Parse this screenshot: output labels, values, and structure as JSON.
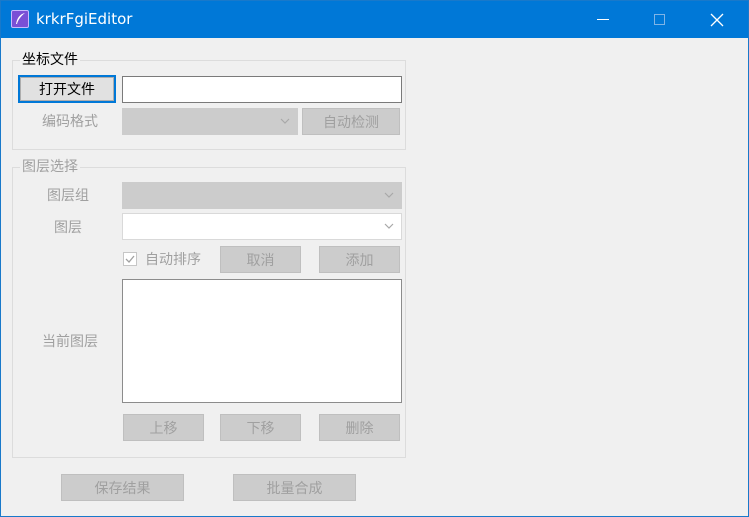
{
  "window": {
    "title": "krkrFgiEditor"
  },
  "coord_file_group": {
    "legend": "坐标文件",
    "open_file_button": "打开文件",
    "file_path_value": "",
    "encoding_label": "编码格式",
    "encoding_value": "",
    "auto_detect_button": "自动检测"
  },
  "layer_select_group": {
    "legend": "图层选择",
    "layer_group_label": "图层组",
    "layer_group_value": "",
    "layer_label": "图层",
    "layer_value": "",
    "auto_sort_label": "自动排序",
    "auto_sort_checked": true,
    "cancel_button": "取消",
    "add_button": "添加",
    "current_layer_label": "当前图层",
    "current_layers": [],
    "move_up_button": "上移",
    "move_down_button": "下移",
    "delete_button": "删除"
  },
  "footer": {
    "save_button": "保存结果",
    "batch_button": "批量合成"
  }
}
